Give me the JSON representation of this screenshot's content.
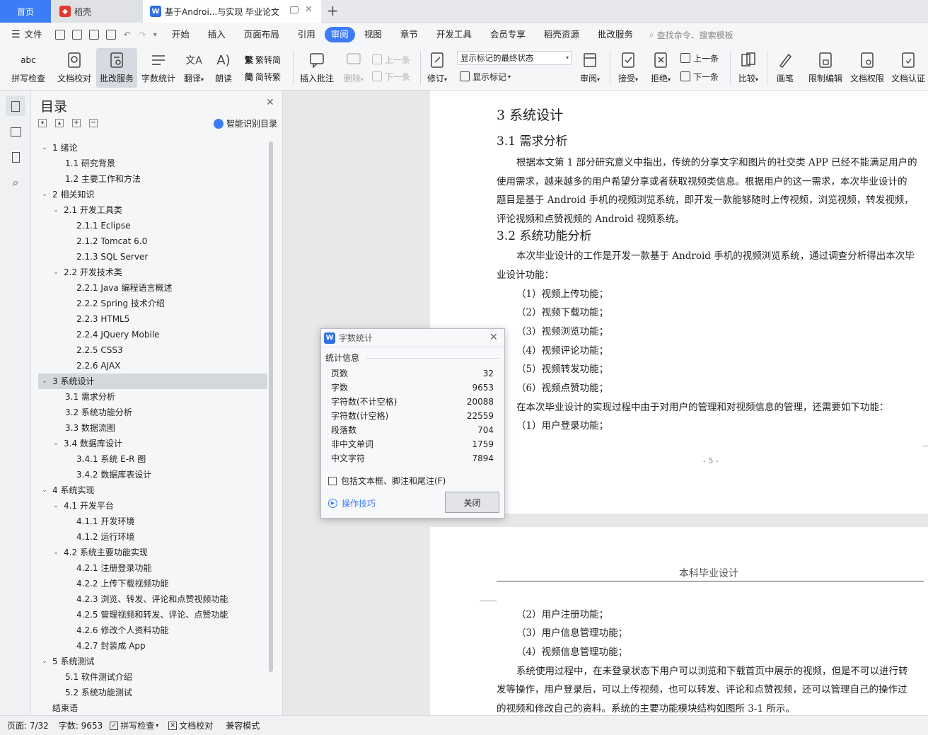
{
  "tabs": {
    "home": "首页",
    "docer": "稻壳",
    "doc": "基于Androi...与实现 毕业论文",
    "new_tab": "+"
  },
  "menu": {
    "file": "文件",
    "items": [
      "开始",
      "插入",
      "页面布局",
      "引用",
      "审阅",
      "视图",
      "章节",
      "开发工具",
      "会员专享",
      "稻壳资源",
      "批改服务"
    ],
    "active": "审阅",
    "search": "查找命令、搜索模板"
  },
  "ribbon": {
    "spell": "拼写检查",
    "proof": "文档校对",
    "grade": "批改服务",
    "count": "字数统计",
    "translate": "翻译",
    "read": "朗读",
    "to_trad": "繁转简",
    "to_simp": "简转繁",
    "insert_comment": "插入批注",
    "delete": "删除",
    "prev": "上一条",
    "next": "下一条",
    "track": "修订",
    "markup_select": "显示标记的最终状态",
    "show_markup": "显示标记",
    "review": "审阅",
    "accept": "接受",
    "reject": "拒绝",
    "prev2": "上一条",
    "next2": "下一条",
    "compare": "比较",
    "pen": "画笔",
    "restrict": "限制编辑",
    "perm": "文档权限",
    "auth": "文档认证"
  },
  "toc": {
    "title": "目录",
    "smart": "智能识别目录",
    "items": [
      {
        "t": "1  绪论",
        "lvl": 1,
        "exp": true
      },
      {
        "t": "1.1 研究背景",
        "lvl": 2
      },
      {
        "t": "1.2 主要工作和方法",
        "lvl": 2
      },
      {
        "t": "2  相关知识",
        "lvl": 1,
        "exp": true
      },
      {
        "t": "2.1 开发工具类",
        "lvl": 2,
        "exp": true
      },
      {
        "t": "2.1.1 Eclipse",
        "lvl": 3
      },
      {
        "t": "2.1.2 Tomcat 6.0",
        "lvl": 3
      },
      {
        "t": "2.1.3 SQL Server",
        "lvl": 3
      },
      {
        "t": "2.2 开发技术类",
        "lvl": 2,
        "exp": true
      },
      {
        "t": "2.2.1 Java 编程语言概述",
        "lvl": 3
      },
      {
        "t": "2.2.2 Spring 技术介绍",
        "lvl": 3
      },
      {
        "t": "2.2.3 HTML5",
        "lvl": 3
      },
      {
        "t": "2.2.4 JQuery Mobile",
        "lvl": 3
      },
      {
        "t": "2.2.5 CSS3",
        "lvl": 3
      },
      {
        "t": "2.2.6 AJAX",
        "lvl": 3
      },
      {
        "t": "3  系统设计",
        "lvl": 1,
        "exp": true,
        "sel": true
      },
      {
        "t": "3.1 需求分析",
        "lvl": 2
      },
      {
        "t": "3.2 系统功能分析",
        "lvl": 2
      },
      {
        "t": "3.3 数据流图",
        "lvl": 2
      },
      {
        "t": "3.4 数据库设计",
        "lvl": 2,
        "exp": true
      },
      {
        "t": "3.4.1 系统 E-R 图",
        "lvl": 3
      },
      {
        "t": "3.4.2 数据库表设计",
        "lvl": 3
      },
      {
        "t": "4  系统实现",
        "lvl": 1,
        "exp": true
      },
      {
        "t": "4.1 开发平台",
        "lvl": 2,
        "exp": true
      },
      {
        "t": "4.1.1 开发环境",
        "lvl": 3
      },
      {
        "t": "4.1.2 运行环境",
        "lvl": 3
      },
      {
        "t": "4.2 系统主要功能实现",
        "lvl": 2,
        "exp": true
      },
      {
        "t": "4.2.1 注册登录功能",
        "lvl": 3
      },
      {
        "t": "4.2.2 上传下载视频功能",
        "lvl": 3
      },
      {
        "t": "4.2.3 浏览、转发、评论和点赞视频功能",
        "lvl": 3
      },
      {
        "t": "4.2.5 管理视频和转发、评论、点赞功能",
        "lvl": 3
      },
      {
        "t": "4.2.6 修改个人资料功能",
        "lvl": 3
      },
      {
        "t": "4.2.7 封装成 App",
        "lvl": 3
      },
      {
        "t": "5  系统测试",
        "lvl": 1,
        "exp": true
      },
      {
        "t": "5.1 软件测试介绍",
        "lvl": 2
      },
      {
        "t": "5.2 系统功能测试",
        "lvl": 2
      },
      {
        "t": "结束语",
        "lvl": 1
      }
    ]
  },
  "page1": {
    "h1": "3  系统设计",
    "h2a": "3.1 需求分析",
    "p1": [
      "根据本文第 1 部分研究意义中指出，传统的分享文字和图片的社交类 APP 已经不能满足用户的",
      "使用需求，越来越多的用户希望分享或者获取视频类信息。根据用户的这一需求，本次毕业设计的",
      "题目是基于 Android 手机的视频浏览系统，即开发一款能够随时上传视频，浏览视频，转发视频，",
      "评论视频和点赞视频的 Android 视频系统。"
    ],
    "h2b": "3.2 系统功能分析",
    "p2": [
      "本次毕业设计的工作是开发一款基于 Android 手机的视频浏览系统，通过调查分析得出本次毕",
      "业设计功能："
    ],
    "list": [
      "（1）视频上传功能；",
      "（2）视频下载功能；",
      "（3）视频浏览功能；",
      "（4）视频评论功能；",
      "（5）视频转发功能；",
      "（6）视频点赞功能；"
    ],
    "p3": "在本次毕业设计的实现过程中由于对用户的管理和对视频信息的管理，还需要如下功能：",
    "list2": "（1）用户登录功能；",
    "page_no": "- 5 -"
  },
  "page2": {
    "header": "本科毕业设计",
    "list": [
      "（2）用户注册功能；",
      "（3）用户信息管理功能；",
      "（4）视频信息管理功能；"
    ],
    "p": [
      "系统使用过程中，在未登录状态下用户可以浏览和下载首页中展示的视频，但是不可以进行转",
      "发等操作，用户登录后，可以上传视频，也可以转发、评论和点赞视频，还可以管理自己的操作过",
      "的视频和修改自己的资料。系统的主要功能模块结构如图所 3-1 所示。"
    ]
  },
  "dialog": {
    "title": "字数统计",
    "section": "统计信息",
    "rows": [
      {
        "k": "页数",
        "v": "32"
      },
      {
        "k": "字数",
        "v": "9653"
      },
      {
        "k": "字符数(不计空格)",
        "v": "20088"
      },
      {
        "k": "字符数(计空格)",
        "v": "22559"
      },
      {
        "k": "段落数",
        "v": "704"
      },
      {
        "k": "非中文单词",
        "v": "1759"
      },
      {
        "k": "中文字符",
        "v": "7894"
      }
    ],
    "checkbox": "包括文本框、脚注和尾注(F)",
    "tips": "操作技巧",
    "close": "关闭"
  },
  "status": {
    "page": "页面: 7/32",
    "words": "字数: 9653",
    "spell": "拼写检查",
    "proof": "文档校对",
    "compat": "兼容模式"
  },
  "colors": {
    "accent": "#3c7cf6",
    "docer_red": "#e6382f",
    "wps_blue": "#2f6fe4"
  }
}
